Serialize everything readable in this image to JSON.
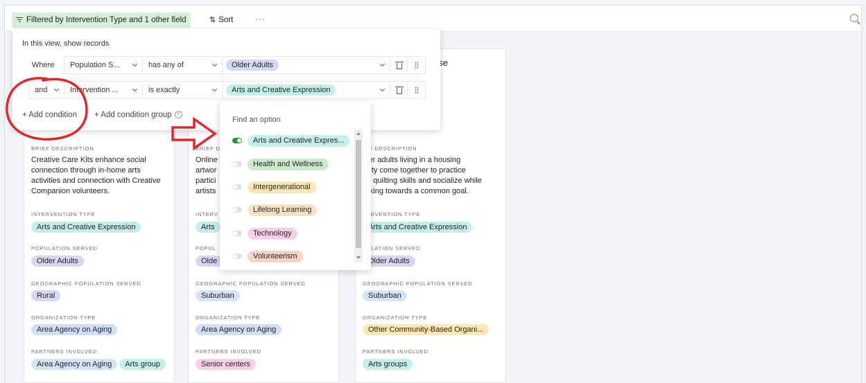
{
  "toolbar": {
    "filter_label": "Filtered by Intervention Type and 1 other field",
    "sort_label": "Sort",
    "more_label": "···"
  },
  "filter_popover": {
    "title": "In this view, show records",
    "conditions": [
      {
        "conjunction": "Where",
        "field": "Population S...",
        "operator": "has any of",
        "value": "Older Adults"
      },
      {
        "conjunction": "and",
        "field": "Intervention ...",
        "operator": "is exactly",
        "value": "Arts and Creative Expression"
      }
    ],
    "add_condition": "+ Add condition",
    "add_condition_group": "+ Add condition group",
    "help_icon": "?"
  },
  "dropdown": {
    "placeholder": "Find an option",
    "options": [
      {
        "label": "Arts and Creative Expres...",
        "on": true,
        "color": "#c3f0ea"
      },
      {
        "label": "Health and Wellness",
        "on": false,
        "color": "#cdebcb"
      },
      {
        "label": "Intergenerational",
        "on": false,
        "color": "#fde7b4"
      },
      {
        "label": "Lifelong Learning",
        "on": false,
        "color": "#fce2c4"
      },
      {
        "label": "Technology",
        "on": false,
        "color": "#f7cfe6"
      },
      {
        "label": "Volunteerism",
        "on": false,
        "color": "#f8d4c5"
      }
    ]
  },
  "cards": [
    {
      "title_fragment": "",
      "brief_description_label": "BRIEF DESCRIPTION",
      "brief_description": "Creative Care Kits enhance social connection through in-home arts activities and connection with Creative Companion volunteers.",
      "intervention_type_label": "INTERVENTION TYPE",
      "intervention_type": "Arts and Creative Expression",
      "population_served_label": "POPULATION SERVED",
      "population_served": "Older Adults",
      "geographic_label": "GEOGRAPHIC POPULATION SERVED",
      "geographic": "Rural",
      "organization_type_label": "ORGANIZATION TYPE",
      "organization_type": "Area Agency on Aging",
      "partners_label": "PARTNERS INVOLVED",
      "partners": [
        "Area Agency on Aging",
        "Arts group"
      ]
    },
    {
      "title_fragment": "",
      "brief_description_label": "BRIEF D",
      "brief_description_lines": [
        "Online",
        "artwor",
        "partici",
        "artists"
      ],
      "intervention_type_label": "INTERV",
      "intervention_type": "Arts",
      "population_served_label": "POPUL",
      "population_served": "Olde",
      "geographic_label": "GEOGRAPHIC POPULATION SERVED",
      "geographic": "Suburban",
      "organization_type_label": "ORGANIZATION TYPE",
      "organization_type": "Area Agency on Aging",
      "partners_label": "PARTNERS INVOLVED",
      "partners": [
        "Senior centers"
      ]
    },
    {
      "title_fragment": "use",
      "brief_description_label": "IEF DESCRIPTION",
      "brief_description_lines": [
        "lder adults living in a housing",
        "cility come together to practice",
        "eir quilting skills and socialize while",
        "orking towards a common goal."
      ],
      "intervention_type_label": "TERVENTION TYPE",
      "intervention_type": "Arts and Creative Expression",
      "population_served_label": "PULATION SERVED",
      "population_served": "Older Adults",
      "geographic_label": "GEOGRAPHIC POPULATION SERVED",
      "geographic": "Suburban",
      "organization_type_label": "ORGANIZATION TYPE",
      "organization_type": "Other Community-Based Organi...",
      "partners_label": "PARTNERS INVOLVED",
      "partners": [
        "Arts groups"
      ]
    }
  ],
  "colors": {
    "filter_chip_bg": "#d6f0d9",
    "annotation_red": "#e0262b",
    "toggle_on": "#1f9d2e"
  }
}
